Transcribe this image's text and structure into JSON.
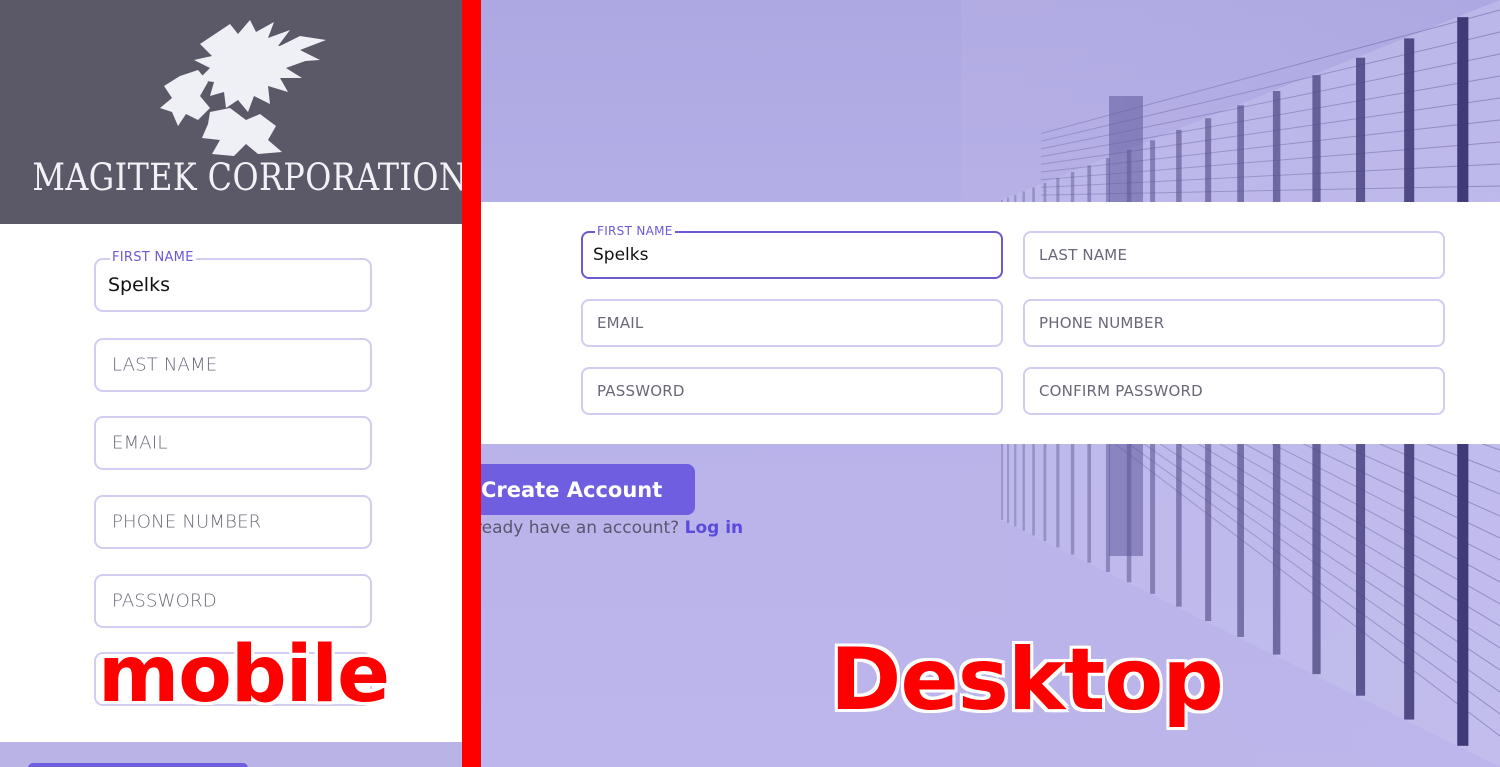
{
  "mobile": {
    "brand": "MAGITEK CORPORATION",
    "first_name": {
      "label": "FIRST NAME",
      "value": "Spelks"
    },
    "fields": {
      "last_name": "LAST NAME",
      "email": "EMAIL",
      "phone": "PHONE NUMBER",
      "password": "PASSWORD"
    },
    "caption": "mobile"
  },
  "desktop": {
    "first_name": {
      "label": "FIRST NAME",
      "value": "Spelks"
    },
    "fields": {
      "last_name": "LAST NAME",
      "email": "EMAIL",
      "phone": "PHONE NUMBER",
      "password": "PASSWORD",
      "confirm_password": "CONFIRM PASSWORD"
    },
    "create_button": "Create Account",
    "login_prompt": "ready have an account?",
    "login_link": "Log in",
    "caption": "Desktop"
  },
  "colors": {
    "accent": "#6f5fe0",
    "label_red": "#ff0000",
    "header_gray": "#5b5868",
    "field_border": "#d2ccf0",
    "background_lavender": "#b9b3e6"
  },
  "icons": [
    "magitek-logo"
  ]
}
